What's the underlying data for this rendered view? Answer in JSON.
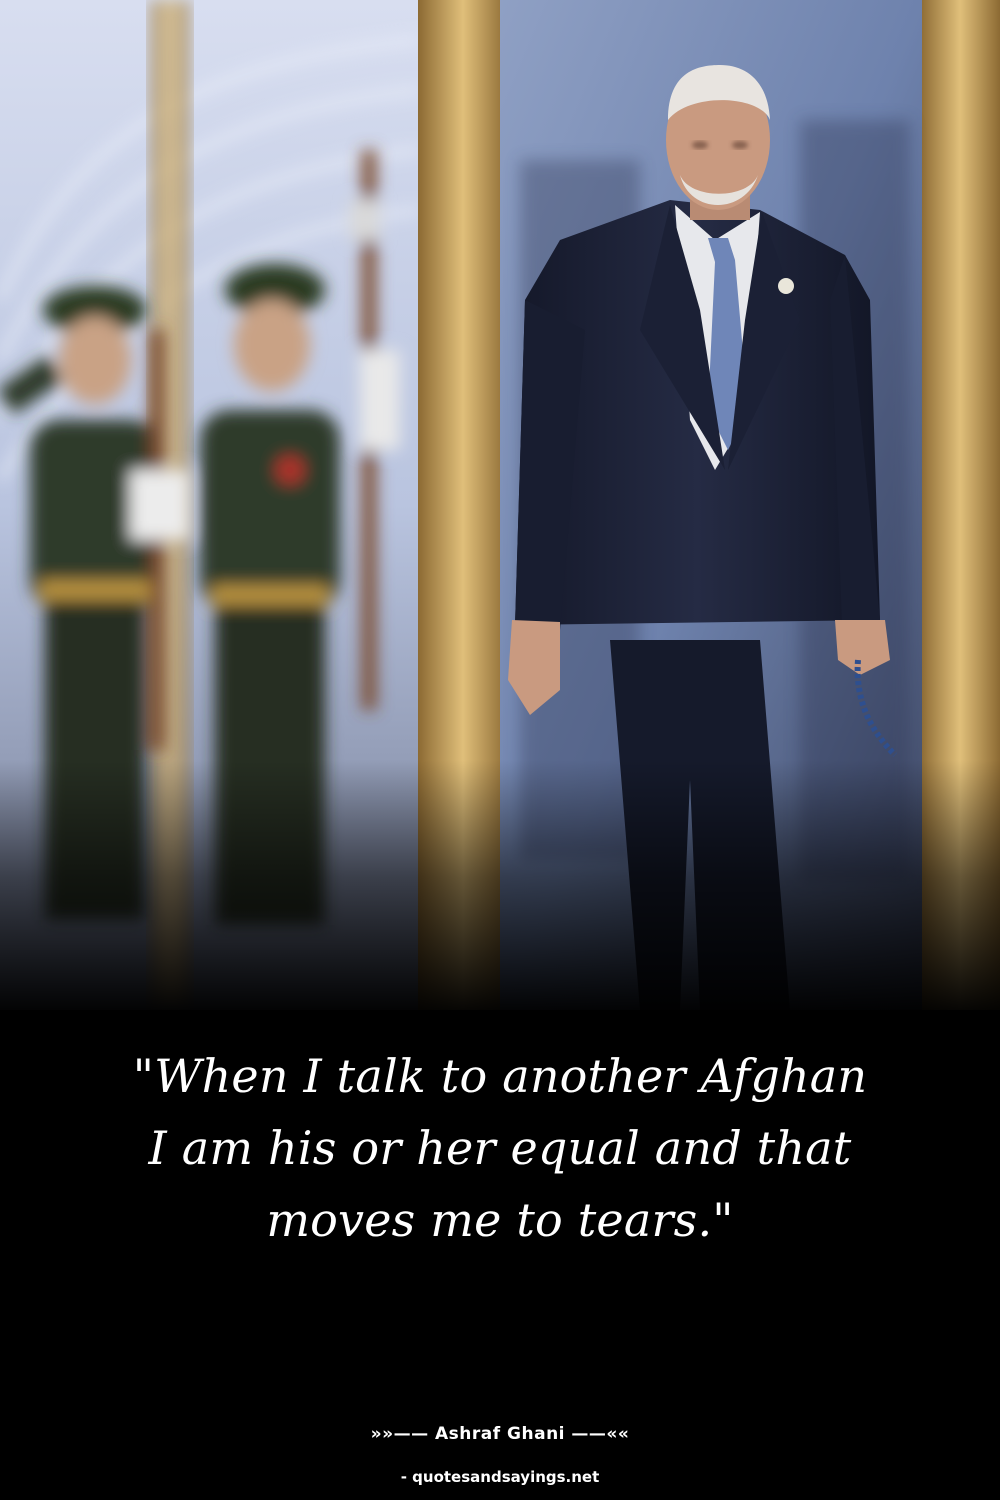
{
  "quote": {
    "text": "\"When I talk to another Afghan I am his or her equal and that moves me to tears.\""
  },
  "attribution": {
    "author_line": "»»—— Ashraf Ghani ——««",
    "source": "- quotesandsayings.net"
  },
  "colors": {
    "background": "#000000",
    "text": "#ffffff",
    "suit": "#1d2236",
    "door_frame": "#c9a25a",
    "uniform": "#2f3a2a"
  }
}
